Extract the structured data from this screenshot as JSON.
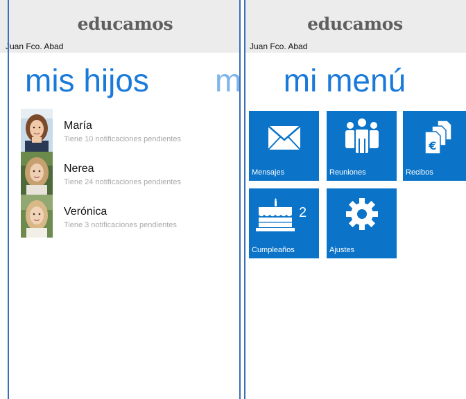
{
  "brand": {
    "logo_text": "educamos",
    "header_bg": "#ececec",
    "accent": "#1a7ad9",
    "tile_color": "#0b74c8",
    "frame_color": "#3a6fb7"
  },
  "user": {
    "name": "Juan Fco. Abad"
  },
  "left_screen": {
    "title": "mis hijos",
    "next_title_peek": "m",
    "children": [
      {
        "name": "María",
        "status": "Tiene 10 notificaciones pendientes",
        "photo_icon": "child-photo-maria"
      },
      {
        "name": "Nerea",
        "status": "Tiene 24 notificaciones pendientes",
        "photo_icon": "child-photo-nerea"
      },
      {
        "name": "Verónica",
        "status": "Tiene 3 notificaciones pendientes",
        "photo_icon": "child-photo-veronica"
      }
    ]
  },
  "right_screen": {
    "title": "mi menú",
    "tiles": [
      {
        "label": "Mensajes",
        "icon": "envelope-icon"
      },
      {
        "label": "Reuniones",
        "icon": "people-icon"
      },
      {
        "label": "Recibos",
        "icon": "receipts-euro-icon"
      },
      {
        "label": "Cumpleaños",
        "icon": "birthday-cake-icon",
        "count": "2"
      },
      {
        "label": "Ajustes",
        "icon": "gear-icon"
      }
    ]
  }
}
